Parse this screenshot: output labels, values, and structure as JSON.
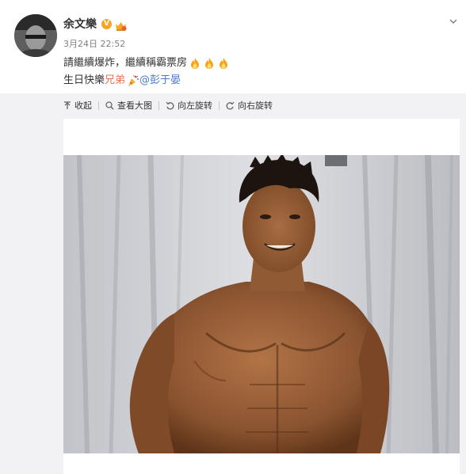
{
  "post": {
    "author": "余文樂",
    "timestamp": "3月24日 22:52",
    "text_line1": "請繼續爆炸，繼續稱霸票房",
    "text_line2_prefix": "生日快樂",
    "text_line2_link": "兄弟",
    "text_line2_mention": "@彭于晏"
  },
  "toolbar": {
    "collapse": "收起",
    "view_large": "查看大图",
    "rotate_left": "向左旋转",
    "rotate_right": "向右旋转"
  },
  "icons": {
    "verified": "verified-v-badge",
    "level": "crown-level-badge",
    "menu": "chevron-down-icon",
    "fire": "fire-emoji",
    "party": "party-popper-emoji",
    "collapse": "arrow-up-icon",
    "zoom": "magnifier-icon",
    "rotate_left": "rotate-left-icon",
    "rotate_right": "rotate-right-icon"
  },
  "colors": {
    "link_red": "#eb7350",
    "link_blue": "#4c7ac8",
    "badge_orange": "#f6a623",
    "media_bg": "#f2f2f5"
  }
}
